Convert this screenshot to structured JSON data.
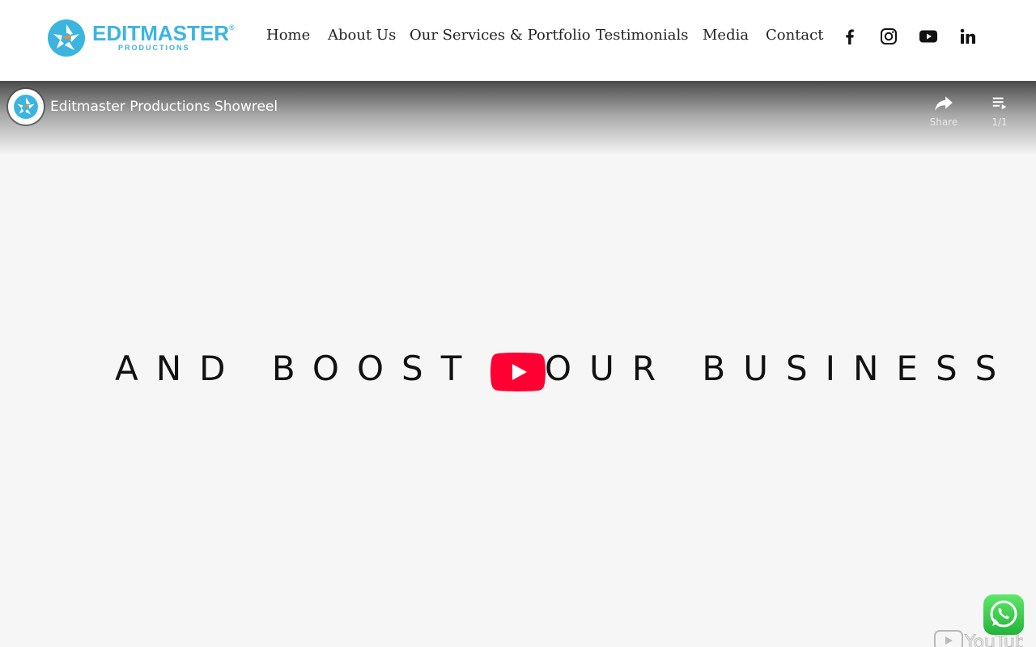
{
  "header": {
    "logo": {
      "brand": "EDITMASTER",
      "sub": "PRODUCTIONS",
      "reg": "®"
    },
    "nav": [
      {
        "label": "Home"
      },
      {
        "label": "About Us"
      },
      {
        "label": "Our Services & Portfolio"
      },
      {
        "label": "Testimonials"
      },
      {
        "label": "Media"
      },
      {
        "label": "Contact"
      }
    ],
    "social": [
      "facebook-icon",
      "instagram-icon",
      "youtube-icon",
      "linkedin-icon"
    ]
  },
  "video": {
    "title": "Editmaster Productions Showreel",
    "share_label": "Share",
    "playlist_label": "1/1",
    "headline": "AND BOOST YOUR BUSINESS",
    "watermark": "YouTube"
  },
  "colors": {
    "brand_blue": "#3cb4e0",
    "brand_orange": "#f28c28",
    "youtube_red": "#ff0033",
    "whatsapp_green": "#25d366"
  }
}
